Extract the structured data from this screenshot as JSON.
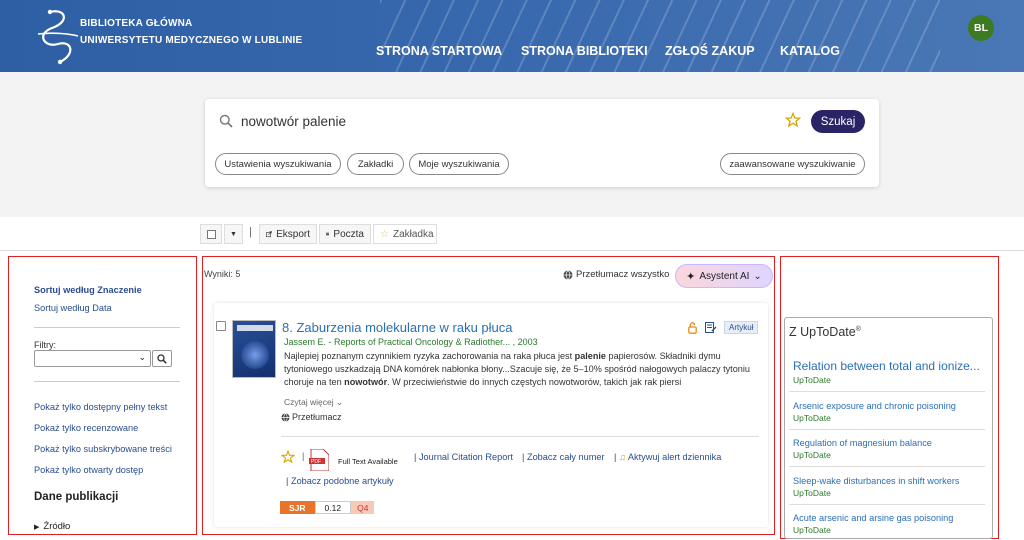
{
  "header": {
    "logo_line1": "BIBLIOTEKA GŁÓWNA",
    "logo_line2": "UNIWERSYTETU MEDYCZNEGO W LUBLINIE",
    "nav": [
      "STRONA STARTOWA",
      "STRONA BIBLIOTEKI",
      "ZGŁOŚ ZAKUP",
      "KATALOG"
    ],
    "avatar": "BL"
  },
  "search": {
    "query": "nowotwór palenie",
    "button": "Szukaj",
    "pills": [
      "Ustawienia wyszukiwania",
      "Zakładki",
      "Moje wyszukiwania"
    ],
    "advanced": "zaawansowane wyszukiwanie"
  },
  "toolbar": {
    "export": "Eksport",
    "mail": "Poczta",
    "bookmark": "Zakładka"
  },
  "sidebar": {
    "sort_relevance": "Sortuj według Znaczenie",
    "sort_date": "Sortuj według Data",
    "filters_label": "Filtry:",
    "links": [
      "Pokaż tylko dostępny pełny tekst",
      "Pokaż tylko recenzowane",
      "Pokaż tylko subskrybowane treści",
      "Pokaż tylko otwarty dostęp"
    ],
    "section": "Dane publikacji",
    "source": "Źródło"
  },
  "results": {
    "count": "Wyniki: 5",
    "translate_all": "Przetłumacz wszystko",
    "ai": "Asystent AI"
  },
  "record": {
    "title": "8. Zaburzenia molekularne w raku płuca",
    "meta": "Jassem E. - Reports of Practical Oncology & Radiother...   , 2003",
    "badge": "Artykuł",
    "abstract": "Najlepiej poznanym czynnikiem ryzyka zachorowania na raka płuca jest palenie papierosów. Składniki dymu tytoniowego uszkadzają DNA komórek nabłonka błony...Szacuje się, że 5–10% spośród nałogowych palaczy tytoniu choruje na ten nowotwór. W przeciwieństwie do innych częstych nowotworów, takich jak rak piersi",
    "read_more": "Czytaj więcej",
    "translate": "Przetłumacz",
    "fulltext": "Full Text Available",
    "actions": [
      "Journal Citation Report",
      "Zobacz cały numer",
      "Aktywuj alert dziennika",
      "Zobacz podobne artykuły"
    ],
    "sjr_label": "SJR",
    "sjr_value": "0.12",
    "sjr_q": "Q4",
    "colors": {
      "sjr_label_bg": "#e8732a",
      "sjr_q_bg": "#f6c9b8"
    }
  },
  "uptodate": {
    "heading": "Z UpToDate",
    "sup": "®",
    "items": [
      {
        "title": "Relation between total and ionize...",
        "src": "UpToDate"
      },
      {
        "title": "Arsenic exposure and chronic poisoning",
        "src": "UpToDate"
      },
      {
        "title": "Regulation of magnesium balance",
        "src": "UpToDate"
      },
      {
        "title": "Sleep-wake disturbances in shift workers",
        "src": "UpToDate"
      },
      {
        "title": "Acute arsenic and arsine gas poisoning",
        "src": "UpToDate"
      }
    ]
  }
}
